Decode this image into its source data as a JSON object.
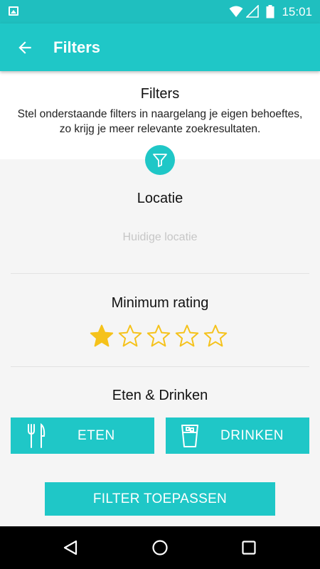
{
  "status_bar": {
    "time": "15:01",
    "icons": [
      "image-icon",
      "wifi-icon",
      "signal-icon",
      "battery-icon"
    ]
  },
  "app_bar": {
    "title": "Filters",
    "back_icon": "arrow-left-icon"
  },
  "intro": {
    "heading": "Filters",
    "description": "Stel onderstaande filters in naargelang je eigen behoeftes, zo krijg je meer relevante zoekresultaten."
  },
  "location": {
    "title": "Locatie",
    "placeholder": "Huidige locatie"
  },
  "rating": {
    "title": "Minimum rating",
    "value": 1,
    "max": 5
  },
  "food_drink": {
    "title": "Eten & Drinken",
    "eat_label": "ETEN",
    "drink_label": "DRINKEN"
  },
  "apply_button": {
    "label": "FILTER TOEPASSEN"
  },
  "colors": {
    "accent": "#1fc7c7",
    "star": "#f5c21b"
  }
}
